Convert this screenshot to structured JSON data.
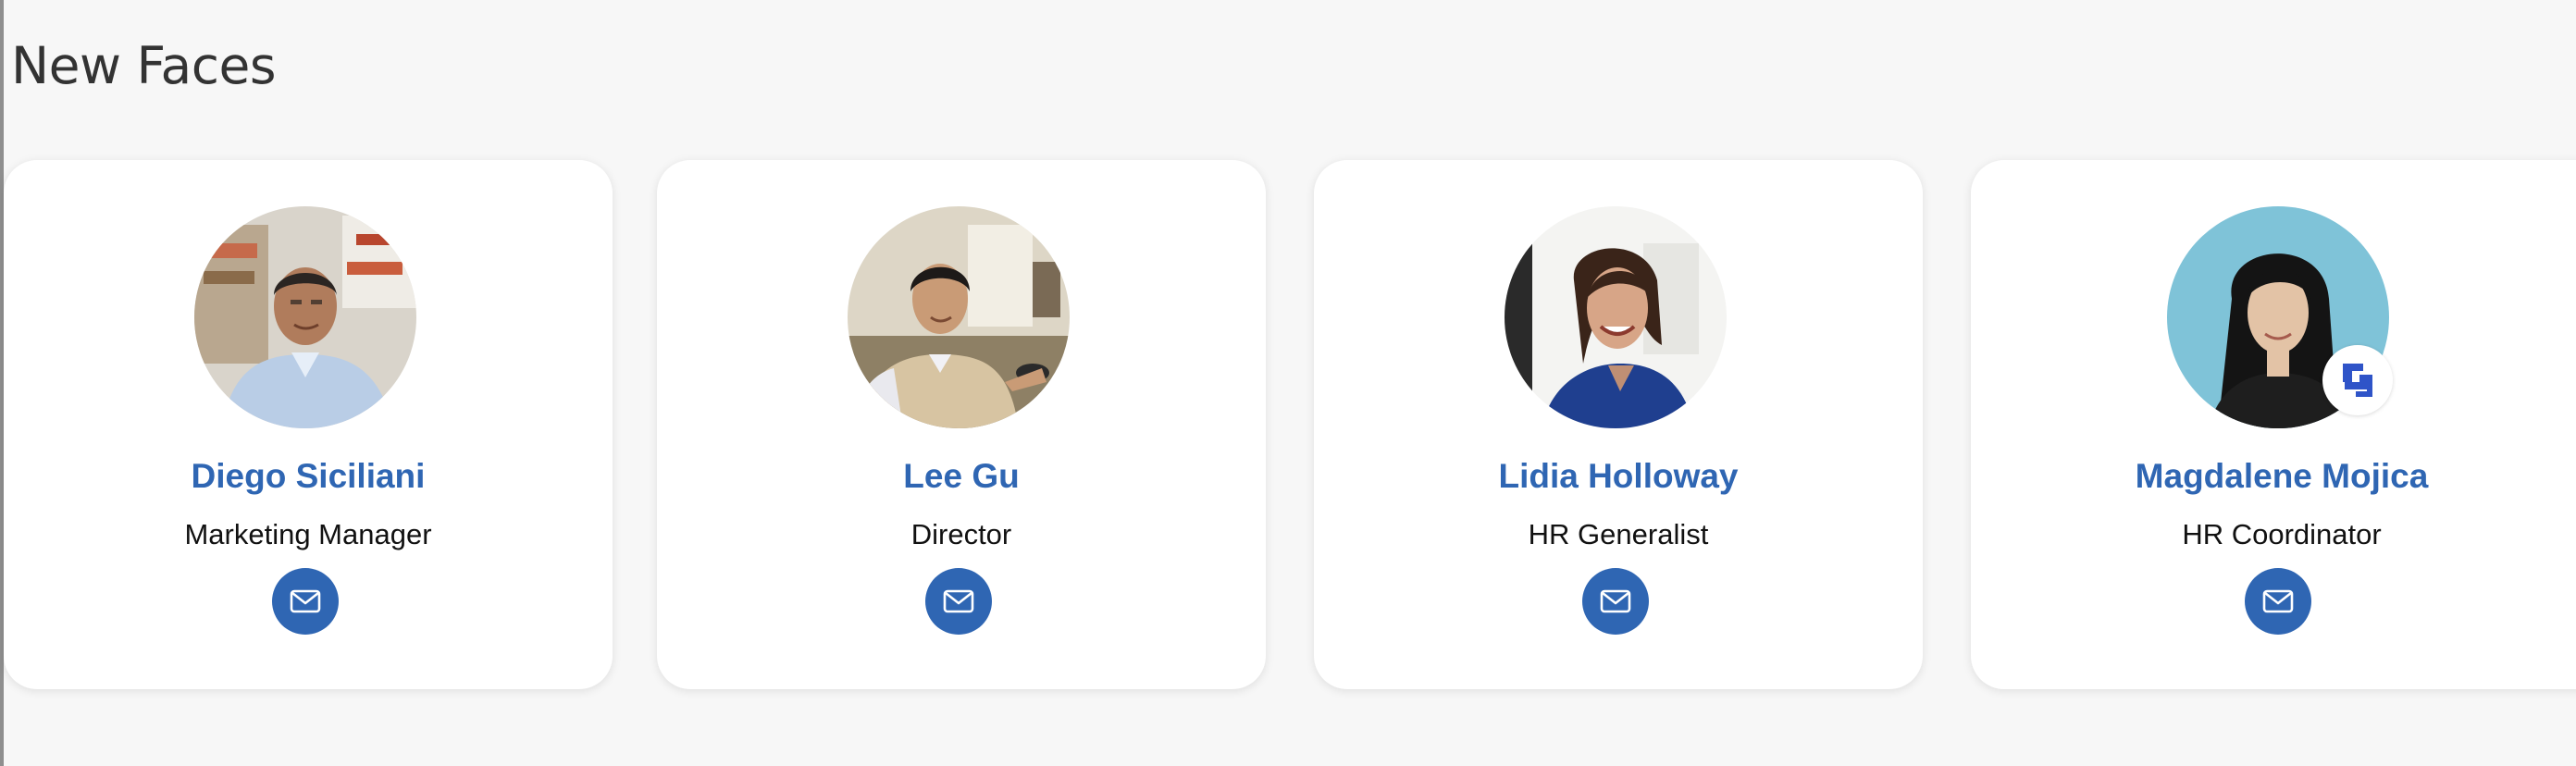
{
  "section": {
    "title": "New Faces"
  },
  "people": [
    {
      "name": "Diego Siciliani",
      "title": "Marketing Manager",
      "avatar_icon": "person-photo",
      "email_icon": "mail-icon"
    },
    {
      "name": "Lee Gu",
      "title": "Director",
      "avatar_icon": "person-photo",
      "email_icon": "mail-icon"
    },
    {
      "name": "Lidia Holloway",
      "title": "HR Generalist",
      "avatar_icon": "person-photo",
      "email_icon": "mail-icon"
    },
    {
      "name": "Magdalene Mojica",
      "title": "HR Coordinator",
      "avatar_icon": "person-photo",
      "email_icon": "mail-icon",
      "badge_icon": "brand-logo-icon"
    }
  ],
  "colors": {
    "accent": "#2f66b3",
    "card": "#ffffff",
    "page": "#f7f7f7",
    "title": "#333333"
  }
}
